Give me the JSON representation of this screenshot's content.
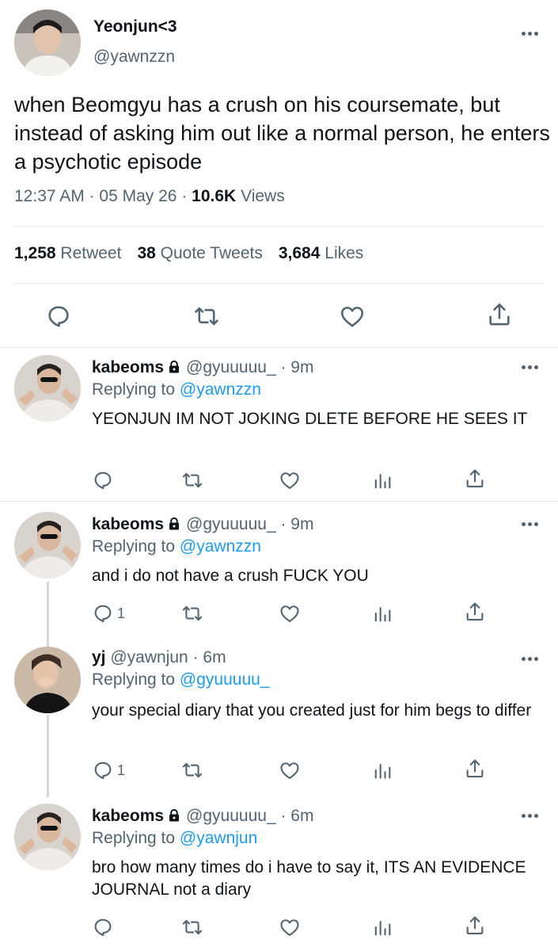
{
  "main_tweet": {
    "display_name": "Yeonjun<3",
    "handle": "@yawnzzn",
    "text": "when Beomgyu has a crush on his coursemate, but instead of asking him out like a normal person, he enters a psychotic episode",
    "time": "12:37 AM",
    "sep1": "·",
    "date": "05 May 26",
    "sep2": "·",
    "views_count": "10.6K",
    "views_label": "Views",
    "retweets_count": "1,258",
    "retweets_label": "Retweet",
    "quotes_count": "38",
    "quotes_label": "Quote Tweets",
    "likes_count": "3,684",
    "likes_label": "Likes",
    "actions": [
      "reply-icon",
      "retweet-icon",
      "like-icon",
      "share-icon"
    ]
  },
  "replies": [
    {
      "name": "kabeoms",
      "handle": "@gyuuuuu_",
      "time": "· 9m",
      "replying_label": "Replying to",
      "replying_to": "@yawnzzn",
      "text": "YEONJUN IM NOT JOKING DLETE BEFORE HE SEES IT",
      "reply_count": ""
    },
    {
      "name": "kabeoms",
      "handle": "@gyuuuuu_",
      "time": "· 9m",
      "replying_label": "Replying to",
      "replying_to": "@yawnzzn",
      "text": "and i do not have a crush FUCK YOU",
      "reply_count": "1"
    },
    {
      "name": "yj",
      "handle": "@yawnjun",
      "time": "· 6m",
      "replying_label": "Replying to",
      "replying_to": "@gyuuuuu_",
      "text": "your special diary that you created just for him begs to differ",
      "reply_count": "1"
    },
    {
      "name": "kabeoms",
      "handle": "@gyuuuuu_",
      "time": "· 6m",
      "replying_label": "Replying to",
      "replying_to": "@yawnjun",
      "text": "bro how many times do i have to say it, ITS AN EVIDENCE JOURNAL not a diary",
      "reply_count": ""
    }
  ],
  "colors": {
    "text": "#0f1419",
    "secondary": "#536471",
    "link": "#1d9bf0",
    "divider": "#e6ecf0"
  }
}
